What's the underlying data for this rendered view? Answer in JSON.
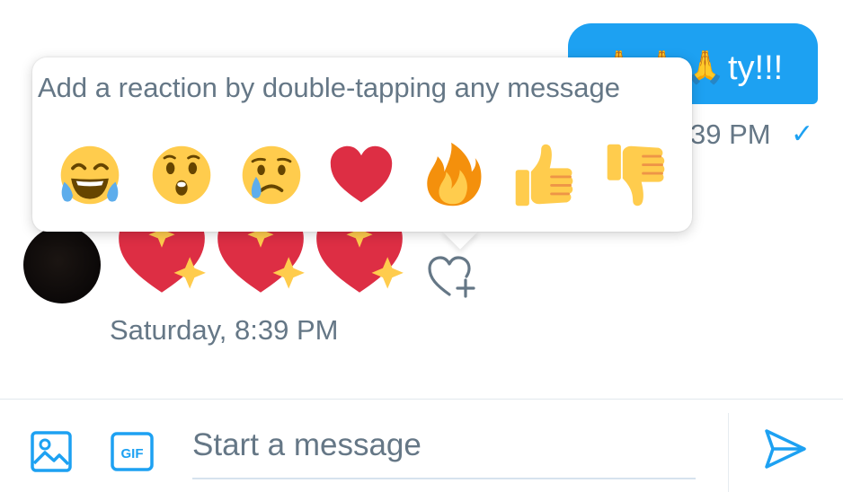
{
  "colors": {
    "accent": "#1da1f2",
    "secondary_text": "#657786",
    "heart_red": "#dd2e44",
    "sparkle_yellow": "#ffcc4d",
    "divider": "#e1e8ed"
  },
  "sent_message": {
    "emoji_count": 3,
    "emoji_icon": "folded-hands-icon",
    "text": "ty!!!",
    "timestamp": "39 PM",
    "status_icon": "checkmark-icon",
    "status_glyph": "✓"
  },
  "reaction_popup": {
    "title": "Add a reaction by double-tapping any message",
    "reactions": [
      {
        "name": "laughing-crying",
        "icon": "face-tears-of-joy-icon"
      },
      {
        "name": "surprised",
        "icon": "hushed-face-icon"
      },
      {
        "name": "sad",
        "icon": "crying-face-icon"
      },
      {
        "name": "heart",
        "icon": "red-heart-icon"
      },
      {
        "name": "fire",
        "icon": "fire-icon"
      },
      {
        "name": "thumbs-up",
        "icon": "thumbs-up-icon"
      },
      {
        "name": "thumbs-down",
        "icon": "thumbs-down-icon"
      }
    ]
  },
  "received_message": {
    "avatar": "user-avatar",
    "emoji_icon": "sparkling-heart-icon",
    "emoji_count": 3,
    "add_reaction_icon": "heart-plus-icon",
    "timestamp": "Saturday, 8:39 PM"
  },
  "composer": {
    "media_icon": "image-icon",
    "gif_icon": "gif-icon",
    "gif_label": "GIF",
    "placeholder": "Start a message",
    "value": "",
    "send_icon": "send-icon"
  }
}
